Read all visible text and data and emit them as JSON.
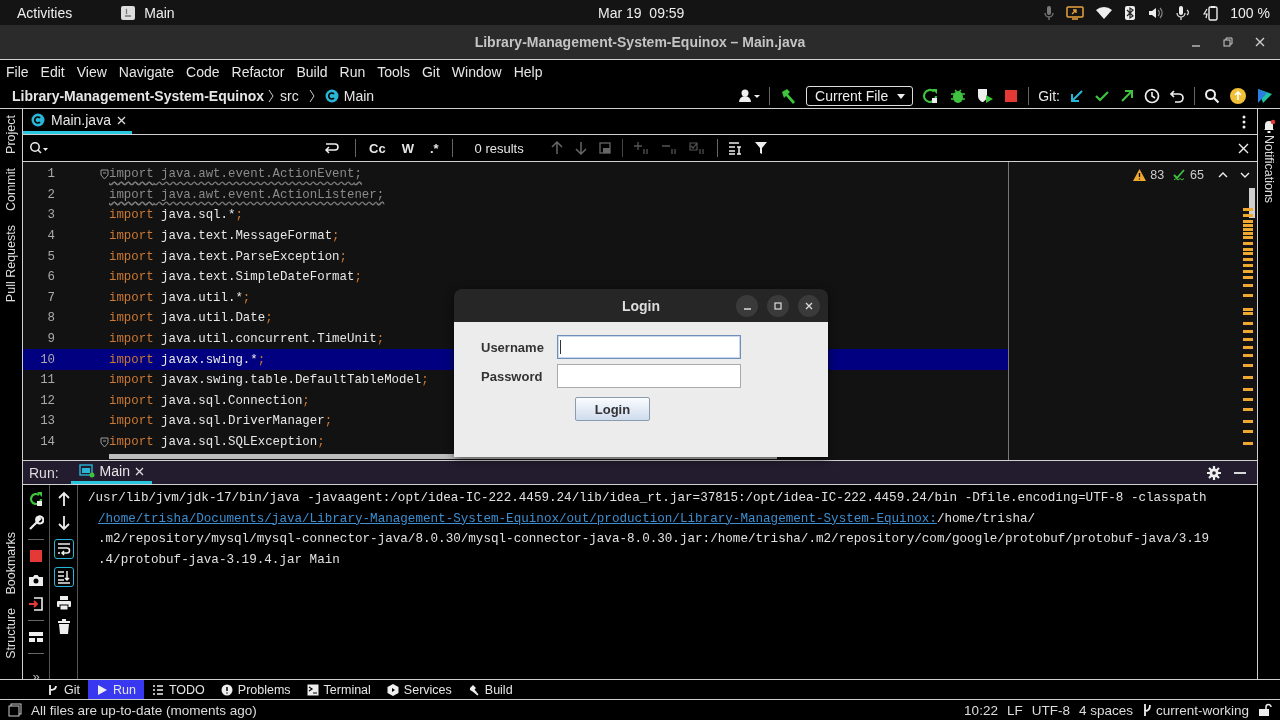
{
  "topbar": {
    "activities": "Activities",
    "app": "Main",
    "date": "Mar 19",
    "time": "09:59",
    "battery": "100 %"
  },
  "window": {
    "title": "Library-Management-System-Equinox – Main.java"
  },
  "menu": [
    "File",
    "Edit",
    "View",
    "Navigate",
    "Code",
    "Refactor",
    "Build",
    "Run",
    "Tools",
    "Git",
    "Window",
    "Help"
  ],
  "breadcrumbs": {
    "project": "Library-Management-System-Equinox",
    "folder": "src",
    "file": "Main"
  },
  "toolbar": {
    "run_config": "Current File",
    "git_label": "Git:"
  },
  "side_left": [
    {
      "label": "Project"
    },
    {
      "label": "Commit"
    },
    {
      "label": "Pull Requests"
    }
  ],
  "side_left_bottom": [
    {
      "label": "Bookmarks"
    },
    {
      "label": "Structure"
    }
  ],
  "side_right": [
    {
      "label": "Notifications"
    }
  ],
  "editor_tabs": [
    {
      "label": "Main.java",
      "selected": true
    }
  ],
  "find": {
    "toggles": [
      {
        "label": "Cc",
        "on": false
      },
      {
        "label": "W",
        "on": false
      },
      {
        "label": ".*",
        "on": false
      }
    ],
    "results": "0 results"
  },
  "inspections": {
    "warnings": "83",
    "weak_warnings": "65"
  },
  "code": [
    {
      "number": "1",
      "keyword": "import",
      "body": "java.awt.event.ActionEvent",
      "end": ";",
      "unused": true,
      "current": false,
      "fold": true
    },
    {
      "number": "2",
      "keyword": "import",
      "body": "java.awt.event.ActionListener",
      "end": ";",
      "unused": true,
      "current": false,
      "fold": false
    },
    {
      "number": "3",
      "keyword": "import",
      "body": "java.sql.*",
      "end": ";",
      "unused": false,
      "current": false,
      "fold": false
    },
    {
      "number": "4",
      "keyword": "import",
      "body": "java.text.MessageFormat",
      "end": ";",
      "unused": false,
      "current": false,
      "fold": false
    },
    {
      "number": "5",
      "keyword": "import",
      "body": "java.text.ParseException",
      "end": ";",
      "unused": false,
      "current": false,
      "fold": false
    },
    {
      "number": "6",
      "keyword": "import",
      "body": "java.text.SimpleDateFormat",
      "end": ";",
      "unused": false,
      "current": false,
      "fold": false
    },
    {
      "number": "7",
      "keyword": "import",
      "body": "java.util.*",
      "end": ";",
      "unused": false,
      "current": false,
      "fold": false
    },
    {
      "number": "8",
      "keyword": "import",
      "body": "java.util.Date",
      "end": ";",
      "unused": false,
      "current": false,
      "fold": false
    },
    {
      "number": "9",
      "keyword": "import",
      "body": "java.util.concurrent.TimeUnit",
      "end": ";",
      "unused": false,
      "current": false,
      "fold": false
    },
    {
      "number": "10",
      "keyword": "import",
      "body": "javax.swing.*",
      "end": ";",
      "unused": false,
      "current": true,
      "fold": false
    },
    {
      "number": "11",
      "keyword": "import",
      "body": "javax.swing.table.DefaultTableModel",
      "end": ";",
      "unused": false,
      "current": false,
      "fold": false
    },
    {
      "number": "12",
      "keyword": "import",
      "body": "java.sql.Connection",
      "end": ";",
      "unused": false,
      "current": false,
      "fold": false
    },
    {
      "number": "13",
      "keyword": "import",
      "body": "java.sql.DriverManager",
      "end": ";",
      "unused": false,
      "current": false,
      "fold": false
    },
    {
      "number": "14",
      "keyword": "import",
      "body": "java.sql.SQLException",
      "end": ";",
      "unused": false,
      "current": false,
      "fold": true
    }
  ],
  "dialog": {
    "title": "Login",
    "fields": [
      {
        "label": "Username",
        "focused": true
      },
      {
        "label": "Password",
        "focused": false
      }
    ],
    "button": "Login"
  },
  "run": {
    "label": "Run:",
    "tabs": [
      {
        "label": "Main",
        "selected": true
      }
    ],
    "soft_wrap": true,
    "scroll_to_end": true,
    "more": "»",
    "console": [
      {
        "wrapped": false,
        "parts": [
          {
            "text": "/usr/lib/jvm/jdk-17/bin/java -javaagent:/opt/idea-IC-222.4459.24/lib/idea_rt.jar=37815:/opt/idea-IC-222.4459.24/bin -Dfile.encoding=UTF-8 -classpath",
            "link": false
          }
        ]
      },
      {
        "wrapped": true,
        "parts": [
          {
            "text": "/home/trisha/Documents/java/Library-Management-System-Equinox/out/production/Library-Management-System-Equinox:",
            "link": true
          },
          {
            "text": "/home/trisha/",
            "link": false
          }
        ]
      },
      {
        "wrapped": true,
        "parts": [
          {
            "text": ".m2/repository/mysql/mysql-connector-java/8.0.30/mysql-connector-java-8.0.30.jar:/home/trisha/.m2/repository/com/google/protobuf/protobuf-java/3.19",
            "link": false
          }
        ]
      },
      {
        "wrapped": true,
        "parts": [
          {
            "text": ".4/protobuf-java-3.19.4.jar Main",
            "link": false
          }
        ]
      }
    ]
  },
  "tool_windows": [
    {
      "label": "Git",
      "selected": false
    },
    {
      "label": "Run",
      "selected": true
    },
    {
      "label": "TODO",
      "selected": false
    },
    {
      "label": "Problems",
      "selected": false
    },
    {
      "label": "Terminal",
      "selected": false
    },
    {
      "label": "Services",
      "selected": false
    },
    {
      "label": "Build",
      "selected": false
    }
  ],
  "status": {
    "message": "All files are up-to-date (moments ago)",
    "position": "10:22",
    "line_separator": "LF",
    "encoding": "UTF-8",
    "indent": "4 spaces",
    "branch": "current-working"
  }
}
